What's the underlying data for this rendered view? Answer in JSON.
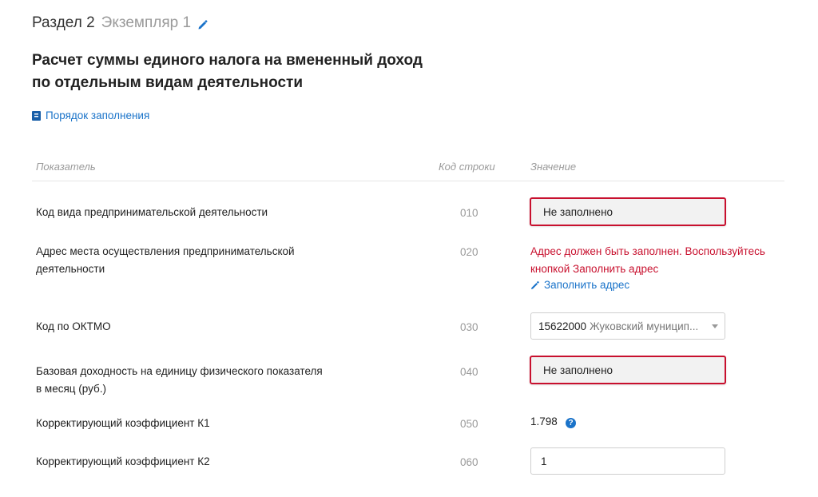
{
  "header": {
    "section": "Раздел 2",
    "instance": "Экземпляр 1",
    "edit_icon": "pencil-icon"
  },
  "title_line1": "Расчет суммы единого налога на вмененный доход",
  "title_line2": "по отдельным видам деятельности",
  "help_link": "Порядок заполнения",
  "columns": {
    "indicator": "Показатель",
    "code": "Код строки",
    "value": "Значение"
  },
  "rows": [
    {
      "label": "Код вида предпринимательской деятельности",
      "code": "010",
      "value": "Не заполнено"
    },
    {
      "label_line1": "Адрес места осуществления предпринимательской",
      "label_line2": "деятельности",
      "code": "020",
      "error_line1": "Адрес должен быть заполнен. Воспользуйтесь",
      "error_line2": "кнопкой Заполнить адрес",
      "action": "Заполнить адрес"
    },
    {
      "label": "Код по ОКТМО",
      "code": "030",
      "select_code": "15622000",
      "select_name": "Жуковский муницип..."
    },
    {
      "label_line1": "Базовая доходность на единицу физического показателя",
      "label_line2": "в месяц (руб.)",
      "code": "040",
      "value": "Не заполнено"
    },
    {
      "label": "Корректирующий коэффициент К1",
      "code": "050",
      "value": "1.798"
    },
    {
      "label": "Корректирующий коэффициент К2",
      "code": "060",
      "value": "1"
    }
  ],
  "colors": {
    "accent": "#1a73c9",
    "error": "#c8102e"
  }
}
